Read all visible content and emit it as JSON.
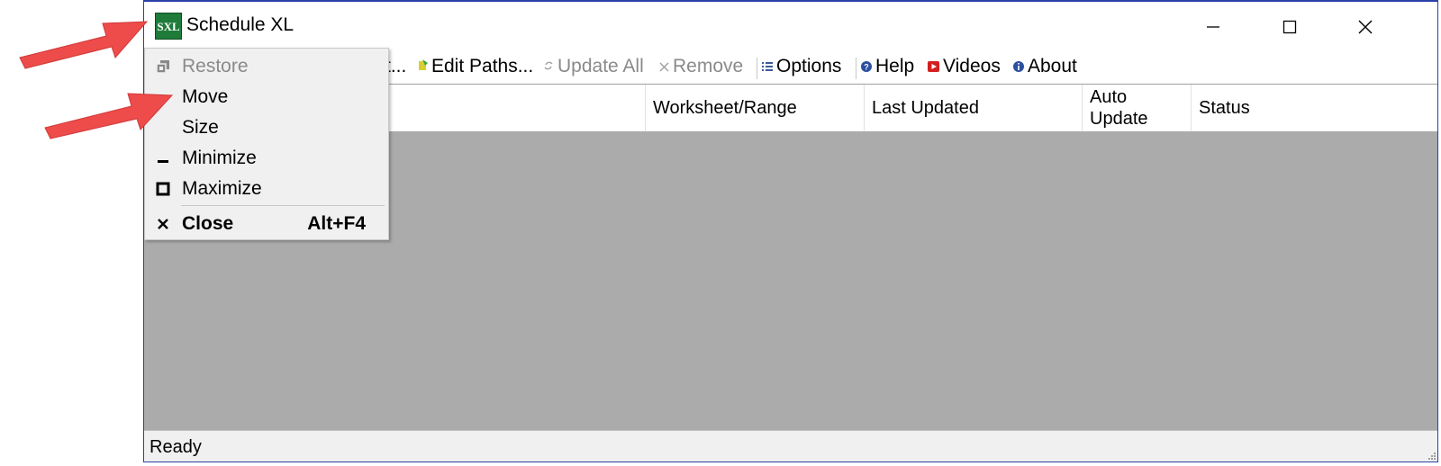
{
  "window": {
    "title": "Schedule XL",
    "app_icon_text": "SXL"
  },
  "toolbar": {
    "truncated_label": "t...",
    "items": [
      {
        "label": "Edit Paths...",
        "icon": "edit-paths-icon",
        "enabled": true
      },
      {
        "label": "Update All",
        "icon": "refresh-icon",
        "enabled": false
      },
      {
        "label": "Remove",
        "icon": "remove-icon",
        "enabled": false
      },
      {
        "label": "Options",
        "icon": "list-icon",
        "enabled": true
      },
      {
        "label": "Help",
        "icon": "help-icon",
        "enabled": true
      },
      {
        "label": "Videos",
        "icon": "video-icon",
        "enabled": true
      },
      {
        "label": "About",
        "icon": "info-icon",
        "enabled": true
      }
    ]
  },
  "grid": {
    "columns": [
      "Worksheet/Range",
      "Last Updated",
      "Auto Update",
      "Status"
    ],
    "auto_update_line1": "Auto",
    "auto_update_line2": "Update",
    "rows": []
  },
  "status_bar": {
    "text": "Ready"
  },
  "system_menu": {
    "items": [
      {
        "label": "Restore",
        "icon": "restore-icon",
        "enabled": false
      },
      {
        "label": "Move",
        "icon": "",
        "enabled": true
      },
      {
        "label": "Size",
        "icon": "",
        "enabled": true
      },
      {
        "label": "Minimize",
        "icon": "minimize-icon",
        "enabled": true
      },
      {
        "label": "Maximize",
        "icon": "maximize-icon",
        "enabled": true
      },
      {
        "label": "Close",
        "icon": "close-icon",
        "enabled": true,
        "shortcut": "Alt+F4"
      }
    ]
  },
  "colors": {
    "annotation_arrow": "#ee4b4b",
    "window_border": "#2b3fa8",
    "grid_background": "#ababab",
    "app_icon_green": "#1e7b3a"
  }
}
